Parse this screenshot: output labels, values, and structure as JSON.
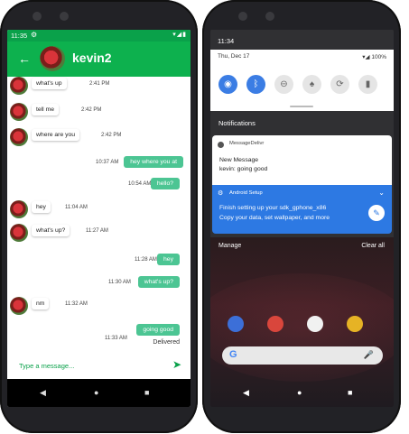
{
  "left_phone": {
    "status_time": "11:35",
    "header": {
      "title": "kevin2"
    },
    "messages": [
      {
        "dir": "in",
        "text": "what's up",
        "time": "2:41 PM"
      },
      {
        "dir": "in",
        "text": "tell me",
        "time": "2:42 PM"
      },
      {
        "dir": "in",
        "text": "where are you",
        "time": "2:42 PM"
      },
      {
        "dir": "out",
        "text": "hey where you at",
        "time": "10:37 AM"
      },
      {
        "dir": "out",
        "text": "hello?",
        "time": "10:54 AM"
      },
      {
        "dir": "in",
        "text": "hey",
        "time": "11:04 AM"
      },
      {
        "dir": "in",
        "text": "what's up?",
        "time": "11:27 AM"
      },
      {
        "dir": "out",
        "text": "hey",
        "time": "11:28 AM"
      },
      {
        "dir": "out",
        "text": "what's up?",
        "time": "11:30 AM"
      },
      {
        "dir": "in",
        "text": "nm",
        "time": "11:32 AM"
      },
      {
        "dir": "out",
        "text": "going good",
        "time": "11:33 AM"
      }
    ],
    "delivered": "Delivered",
    "input_placeholder": "Type a message..."
  },
  "right_phone": {
    "status_time": "11:34",
    "qs": {
      "date": "Thu, Dec 17",
      "battery": "100%"
    },
    "notifications_header": "Notifications",
    "notif1": {
      "app": "MessageDelivr",
      "title": "New Message",
      "body": "kevin: going good"
    },
    "notif2": {
      "app": "Android Setup",
      "line1": "Finish setting up your sdk_gphone_x86",
      "line2": "Copy your data, set wallpaper, and more"
    },
    "manage": "Manage",
    "clear_all": "Clear all"
  },
  "colors": {
    "green": "#0db14e",
    "bubble_out": "#4cc593",
    "blue": "#2d79e3"
  }
}
